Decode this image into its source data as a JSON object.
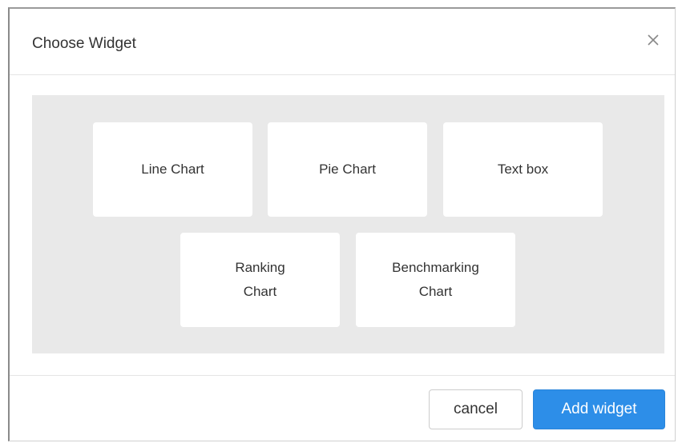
{
  "modal": {
    "title": "Choose Widget",
    "close_icon": "close-icon"
  },
  "widgets": [
    {
      "label": "Line Chart"
    },
    {
      "label": "Pie Chart"
    },
    {
      "label": "Text box"
    },
    {
      "label": "Ranking\nChart"
    },
    {
      "label": "Benchmarking\nChart"
    }
  ],
  "footer": {
    "cancel_label": "cancel",
    "add_label": "Add widget"
  },
  "colors": {
    "primary": "#2d8ee8",
    "widget_area_bg": "#e9e9e9"
  }
}
